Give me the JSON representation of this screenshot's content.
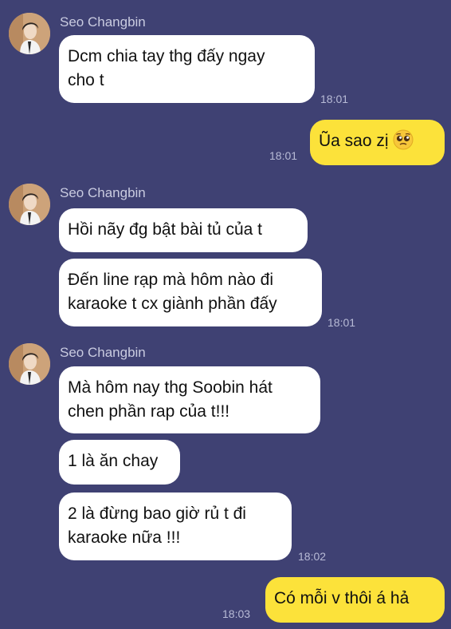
{
  "sender_name": "Seo Changbin",
  "groups": [
    {
      "messages": [
        {
          "lines": [
            "Dcm chia tay thg đấy ngay",
            "cho t"
          ],
          "time": "18:01"
        }
      ]
    },
    {
      "messages": [
        {
          "lines": [
            "Hồi nãy đg bật bài tủ của t"
          ]
        },
        {
          "lines": [
            "Đến line rạp mà hôm nào đi",
            "karaoke t cx giành phần đấy"
          ],
          "time": "18:01"
        }
      ]
    },
    {
      "messages": [
        {
          "lines": [
            "Mà hôm nay thg Soobin hát",
            "chen phần rap của t!!!"
          ]
        },
        {
          "lines": [
            "1 là ăn chay"
          ]
        },
        {
          "lines": [
            "2 là đừng bao giờ rủ t đi",
            "karaoke nữa !!!"
          ],
          "time": "18:02"
        }
      ]
    }
  ],
  "outgoing": [
    {
      "text": "Ũa sao zị",
      "emoji": "pleading-face-emoji",
      "time": "18:01"
    },
    {
      "text": "Có mỗi v thôi á hả",
      "time": "18:03"
    }
  ],
  "colors": {
    "background": "#3f4173",
    "incoming_bubble": "#ffffff",
    "outgoing_bubble": "#fce23a",
    "meta_text": "#b8bbd6"
  }
}
